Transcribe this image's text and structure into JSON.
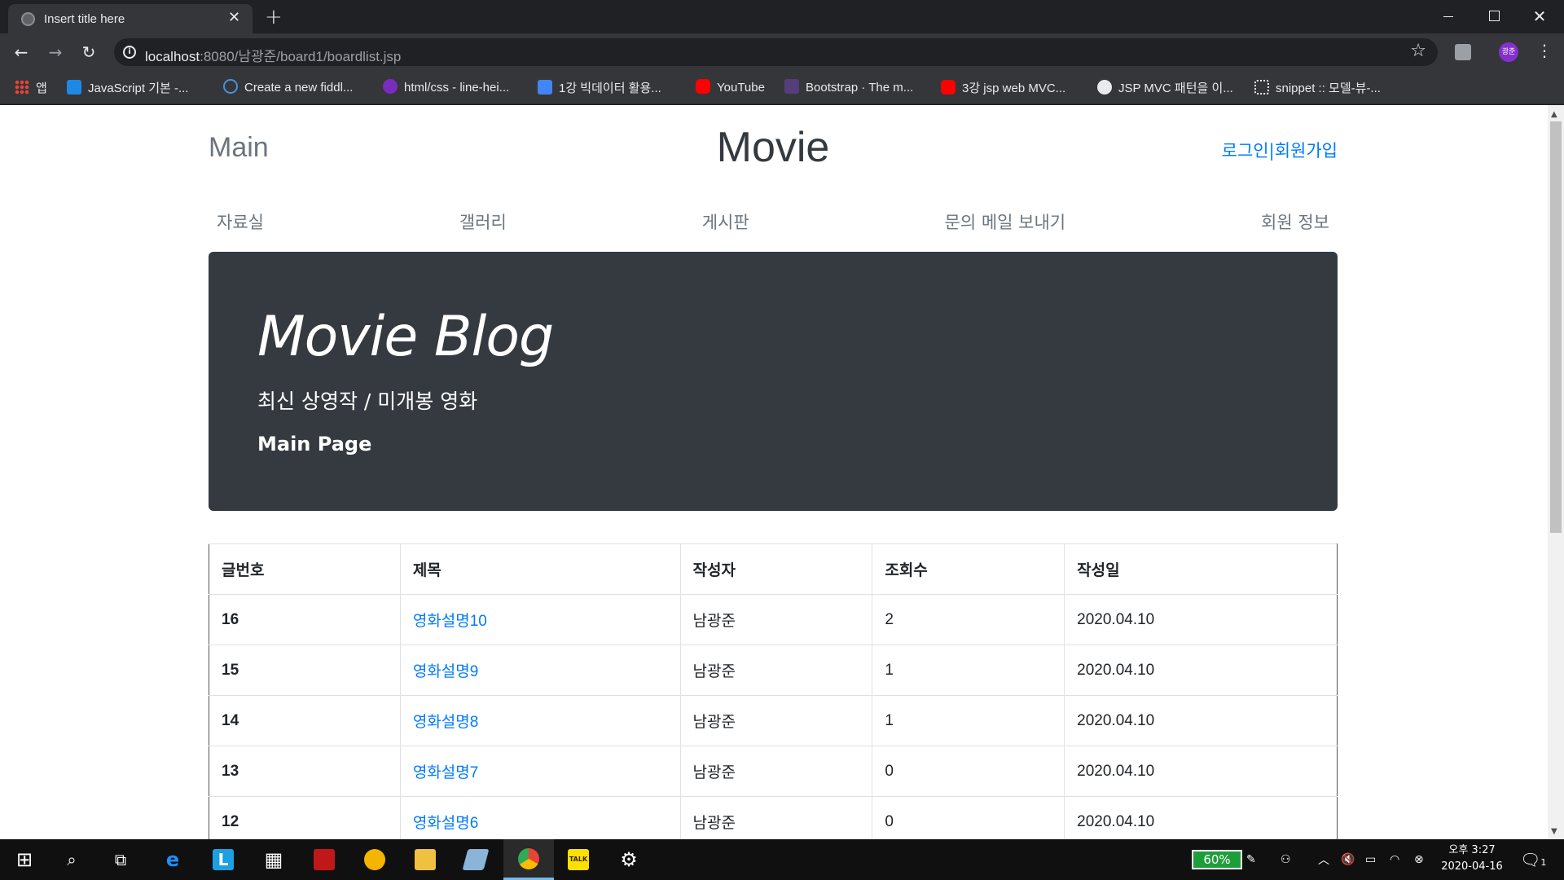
{
  "browser": {
    "tab_title": "Insert title here",
    "url_host": "localhost",
    "url_path": ":8080/남광준/board1/boardlist.jsp",
    "profile_initials": "광준",
    "bookmarks": [
      {
        "label": "앱",
        "icon": "apps-grid-icon"
      },
      {
        "label": "JavaScript 기본 -...",
        "icon": "bookmark-js-icon",
        "color": "#1e88e5"
      },
      {
        "label": "Create a new fiddl...",
        "icon": "jsfiddle-icon",
        "color": "#4a90d9"
      },
      {
        "label": "html/css - line-hei...",
        "icon": "bookmark-css-icon",
        "color": "#7b2cbf"
      },
      {
        "label": "1강 빅데이터 활용...",
        "icon": "google-docs-icon",
        "color": "#4285f4"
      },
      {
        "label": "YouTube",
        "icon": "youtube-icon",
        "color": "#ff0000"
      },
      {
        "label": "Bootstrap · The m...",
        "icon": "bootstrap-icon",
        "color": "#563d7c"
      },
      {
        "label": "3강 jsp web MVC...",
        "icon": "youtube-icon",
        "color": "#ff0000"
      },
      {
        "label": "JSP MVC 패턴을 이...",
        "icon": "github-icon",
        "color": "#e8eaed"
      },
      {
        "label": "snippet :: 모델-뷰-...",
        "icon": "snippet-icon",
        "color": "#e8eaed"
      }
    ]
  },
  "page": {
    "header": {
      "main_link": "Main",
      "site_title": "Movie",
      "login": "로그인",
      "separator": "|",
      "signup": "회원가입"
    },
    "nav": [
      "자료실",
      "갤러리",
      "게시판",
      "문의 메일 보내기",
      "회원 정보"
    ],
    "jumbotron": {
      "title": "Movie Blog",
      "lead": "최신 상영작 / 미개봉 영화",
      "subtitle": "Main Page"
    },
    "table": {
      "headers": [
        "글번호",
        "제목",
        "작성자",
        "조회수",
        "작성일"
      ],
      "rows": [
        {
          "no": "16",
          "title": "영화설명10",
          "author": "남광준",
          "views": "2",
          "date": "2020.04.10"
        },
        {
          "no": "15",
          "title": "영화설명9",
          "author": "남광준",
          "views": "1",
          "date": "2020.04.10"
        },
        {
          "no": "14",
          "title": "영화설명8",
          "author": "남광준",
          "views": "1",
          "date": "2020.04.10"
        },
        {
          "no": "13",
          "title": "영화설명7",
          "author": "남광준",
          "views": "0",
          "date": "2020.04.10"
        },
        {
          "no": "12",
          "title": "영화설명6",
          "author": "남광준",
          "views": "0",
          "date": "2020.04.10"
        }
      ]
    }
  },
  "taskbar": {
    "battery_percent": "60%",
    "clock_time": "오후 3:27",
    "clock_date": "2020-04-16",
    "notification_count": "1"
  },
  "colors": {
    "link": "#007bff",
    "jumbotron_bg": "#343a40",
    "browser_dark": "#202124"
  }
}
